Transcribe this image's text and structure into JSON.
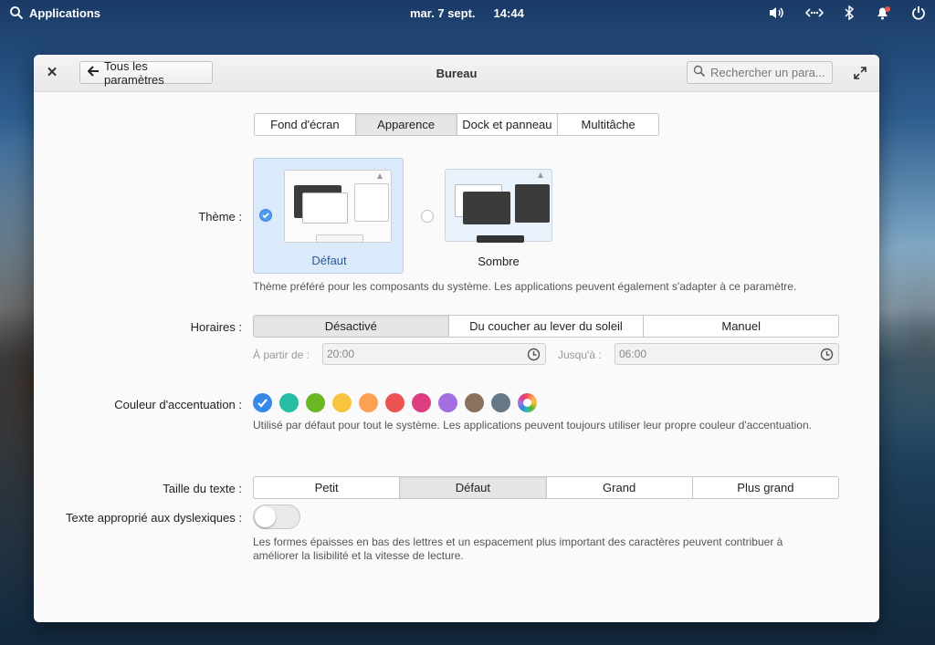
{
  "panel": {
    "applications_label": "Applications",
    "date": "mar. 7 sept.",
    "time": "14:44"
  },
  "window": {
    "title": "Bureau",
    "back_label": "Tous les paramètres",
    "search_placeholder": "Rechercher un para..."
  },
  "tabs": [
    "Fond d'écran",
    "Apparence",
    "Dock et panneau",
    "Multitâche"
  ],
  "active_tab": "Apparence",
  "theme": {
    "label": "Thème :",
    "options": [
      "Défaut",
      "Sombre"
    ],
    "selected": "Défaut",
    "description": "Thème préféré pour les composants du système. Les applications peuvent également s'adapter à ce paramètre."
  },
  "schedule": {
    "label": "Horaires :",
    "options": [
      "Désactivé",
      "Du coucher au lever du soleil",
      "Manuel"
    ],
    "selected": "Désactivé",
    "from_label": "À partir de :",
    "from_value": "20:00",
    "to_label": "Jusqu'à :",
    "to_value": "06:00"
  },
  "accent": {
    "label": "Couleur d'accentuation :",
    "colors": [
      "#3689e6",
      "#28bca3",
      "#68b723",
      "#f9c440",
      "#ffa154",
      "#ed5353",
      "#de3e80",
      "#a56de2",
      "#8a715e",
      "#667885"
    ],
    "selected_index": 0,
    "description": "Utilisé par défaut pour tout le système. Les applications peuvent toujours utiliser leur propre couleur d'accentuation."
  },
  "text_size": {
    "label": "Taille du texte :",
    "options": [
      "Petit",
      "Défaut",
      "Grand",
      "Plus grand"
    ],
    "selected": "Défaut"
  },
  "dyslexia": {
    "label": "Texte approprié aux dyslexiques :",
    "enabled": false,
    "description_line1": "Les formes épaisses en bas des lettres et un espacement plus important des caractères peuvent contribuer à",
    "description_line2": "améliorer la lisibilité et la vitesse de lecture."
  }
}
